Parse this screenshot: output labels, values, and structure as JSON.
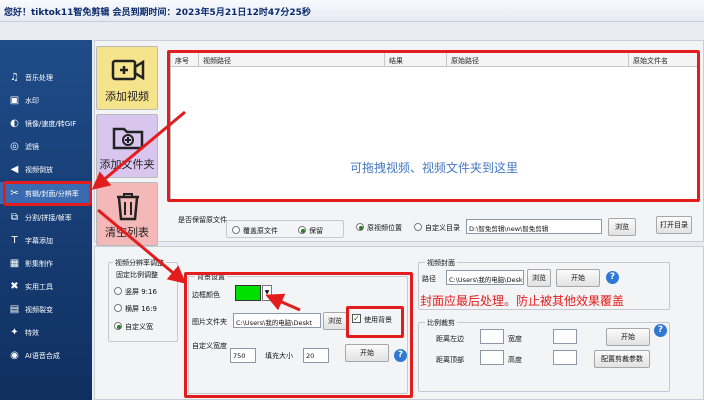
{
  "title": "您好！tiktok11智免剪辑  会员到期时间：2023年5月21日12时47分25秒",
  "colors": {
    "sidebar": "#1a3f7a",
    "highlight": "#e31d1d",
    "hint": "#4578c2",
    "border_color": "#00e000"
  },
  "sidebar": {
    "items": [
      {
        "label": "音乐处理",
        "icon": "music-icon"
      },
      {
        "label": "水印",
        "icon": "watermark-icon"
      },
      {
        "label": "镜像/速度/转GIF",
        "icon": "mirror-icon"
      },
      {
        "label": "滤镜",
        "icon": "filter-icon"
      },
      {
        "label": "视频倒放",
        "icon": "reverse-icon"
      },
      {
        "label": "剪辑/封面/分辨率",
        "icon": "scissors-icon"
      },
      {
        "label": "分割/拼接/帧率",
        "icon": "split-icon"
      },
      {
        "label": "字幕添加",
        "icon": "subtitle-icon"
      },
      {
        "label": "影集制作",
        "icon": "album-icon"
      },
      {
        "label": "实用工具",
        "icon": "tools-icon"
      },
      {
        "label": "视频裂变",
        "icon": "fission-icon"
      },
      {
        "label": "特效",
        "icon": "effects-icon"
      },
      {
        "label": "AI语音合成",
        "icon": "ai-voice-icon"
      }
    ]
  },
  "actions": {
    "add_video": "添加视频",
    "add_folder": "添加文件夹",
    "clear_list": "清空列表"
  },
  "table": {
    "columns": [
      "序号",
      "视频路径",
      "结果",
      "原始路径",
      "原始文件名"
    ],
    "drop_hint": "可拖拽视频、视频文件夹到这里"
  },
  "keep_source": {
    "label": "是否保留原文件",
    "options": [
      "覆盖原文件",
      "保留"
    ],
    "selected": "保留"
  },
  "output": {
    "options": [
      "原视频位置",
      "自定义目录"
    ],
    "selected": "原视频位置",
    "path": "D:\\智免剪辑\\new\\智免剪辑",
    "browse": "浏览",
    "open_dir": "打开目录"
  },
  "resolution": {
    "title": "视频分辨率调整",
    "fixed_ratio": "固定比例调整",
    "options": [
      "竖屏 9:16",
      "横屏 16:9",
      "自定义宽"
    ],
    "selected": "自定义宽"
  },
  "background": {
    "title": "背景设置",
    "border_color": "边框颜色",
    "image_folder": "图片文件夹",
    "folder_path": "C:\\Users\\我的电脑\\Deskt",
    "browse": "浏览",
    "use_bg": "使用背景",
    "custom_width": "自定义宽度",
    "width": "750",
    "fill": "填充大小",
    "fill_value": "20",
    "start": "开始"
  },
  "cover": {
    "title": "视频封面",
    "path_label": "路径",
    "path": "C:\\Users\\我的电脑\\Deskt",
    "browse": "浏览",
    "start": "开始",
    "annotation": "封面应最后处理。防止被其他效果覆盖"
  },
  "crop": {
    "title": "比例裁剪",
    "left": "距离左边",
    "width": "宽度",
    "top": "距离顶部",
    "height": "高度",
    "start": "开始",
    "params": "配置剪裁参数"
  }
}
